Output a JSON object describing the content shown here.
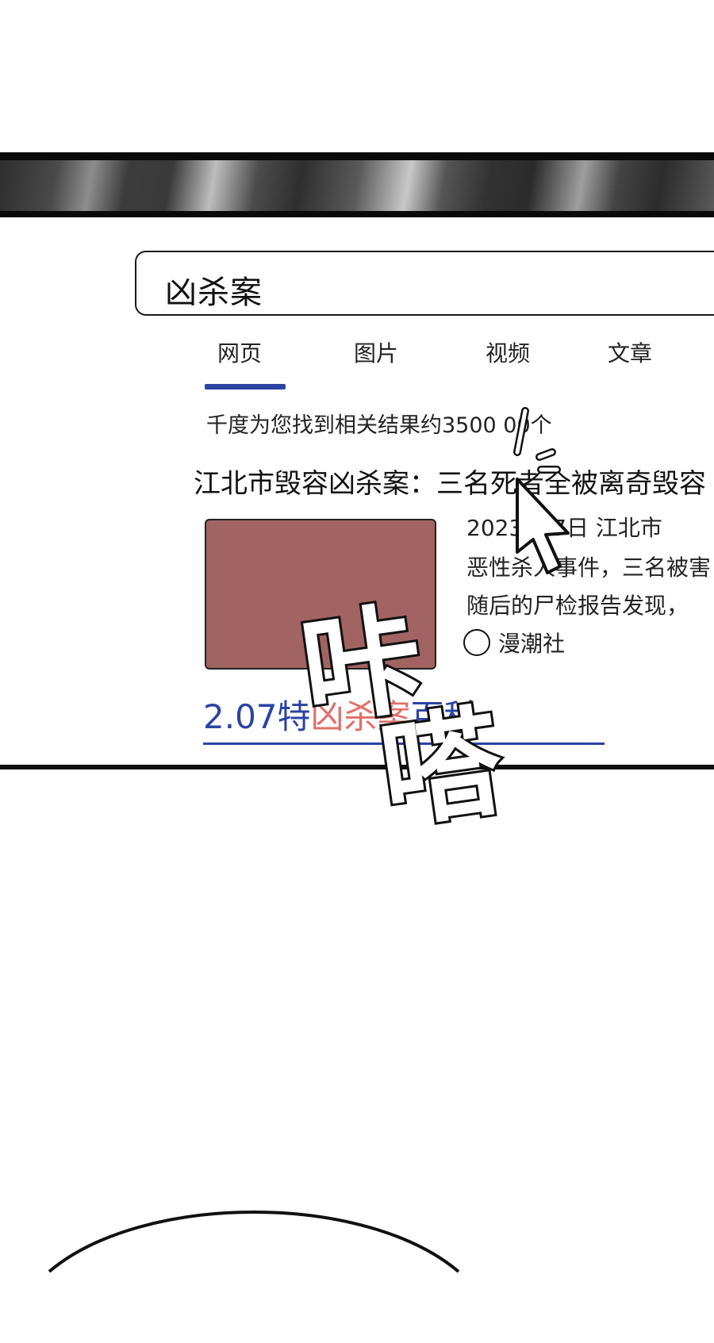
{
  "search": {
    "query": "凶杀案"
  },
  "tabs": [
    {
      "label": "网页",
      "active": true
    },
    {
      "label": "图片"
    },
    {
      "label": "视频"
    },
    {
      "label": "文章"
    }
  ],
  "results": {
    "count_text": "千度为您找到相关结果约3500 00个",
    "first": {
      "title": "江北市毁容凶杀案：三名死者全被离奇毁容",
      "snippet_lines": [
        "2023  月7日  江北市",
        "恶性杀人事件，三名被害",
        "随后的尸检报告发现，"
      ],
      "source": "漫潮社"
    },
    "wiki_link": {
      "prefix": "2.07特",
      "highlight": "凶杀案",
      "suffix": "百科"
    }
  },
  "sfx_text": "咔嗒",
  "colors": {
    "accent": "#2b43a3",
    "thumbnail": "#a26363",
    "highlight": "#e0706a"
  },
  "icons": [
    "mouse-cursor-icon",
    "source-circle-icon"
  ]
}
